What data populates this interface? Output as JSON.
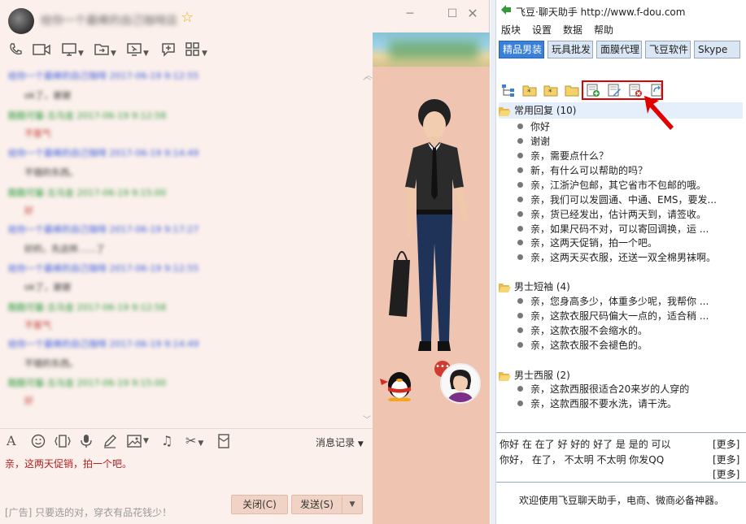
{
  "chat": {
    "contact_name": "给你一个最棒的自己咖啡店",
    "window_buttons": {
      "minimize": "─",
      "maximize": "☐",
      "close": "✕"
    },
    "messages": [
      {
        "kind": "header-blue",
        "text": "给你一个最棒的自己咖啡 2017-06-19 9:12:55"
      },
      {
        "kind": "body",
        "text": "ok了，谢谢"
      },
      {
        "kind": "header-green",
        "text": "酷酷可馨-五乌金 2017-06-19 9:12:58"
      },
      {
        "kind": "red",
        "text": "不客气"
      },
      {
        "kind": "header-blue",
        "text": "给你一个最棒的自己咖啡 2017-06-19 9:14:49"
      },
      {
        "kind": "body",
        "text": "不错的东西。"
      },
      {
        "kind": "header-green",
        "text": "酷酷可馨-五乌金 2017-06-19 9:15:00"
      },
      {
        "kind": "red",
        "text": "好"
      },
      {
        "kind": "header-blue",
        "text": "给你一个最棒的自己咖啡 2017-06-19 9:17:27"
      },
      {
        "kind": "body",
        "text": "好的，先这样……了"
      },
      {
        "kind": "header-blue",
        "text": "给你一个最棒的自己咖啡 2017-06-19 9:12:55"
      },
      {
        "kind": "body",
        "text": "ok了，谢谢"
      },
      {
        "kind": "header-green",
        "text": "酷酷可馨-五乌金 2017-06-19 9:12:58"
      },
      {
        "kind": "red",
        "text": "不客气"
      },
      {
        "kind": "header-blue",
        "text": "给你一个最棒的自己咖啡 2017-06-19 9:14:49"
      },
      {
        "kind": "body",
        "text": "不错的东西。"
      },
      {
        "kind": "header-green",
        "text": "酷酷可馨-五乌金 2017-06-19 9:15:00"
      },
      {
        "kind": "red",
        "text": "好"
      }
    ],
    "history_label": "消息记录",
    "input_text": "亲，这两天促销，拍一个吧。",
    "ad_text": "[广告] 只要选的对，穿衣有品花钱少！",
    "close_label": "关闭(C)",
    "send_label": "发送(S)",
    "badge": "•••"
  },
  "helper": {
    "title": "飞豆·聊天助手 http://www.f-dou.com",
    "menu": [
      "版块",
      "设置",
      "数据",
      "帮助"
    ],
    "tabs": [
      "精品男装",
      "玩具批发",
      "面膜代理",
      "飞豆软件",
      "Skype"
    ],
    "groups": [
      {
        "name": "常用回复 (10)",
        "items": [
          "你好",
          "谢谢",
          "亲，需要点什么？",
          "新，有什么可以帮助的吗？",
          "亲，江浙沪包邮，其它省市不包邮的哦。",
          "亲，我们可以发圆通、中通、EMS，要发...",
          "亲，货已经发出，估计两天到，请签收。",
          "亲，如果尺码不对，可以寄回调换，运 ...",
          "亲，这两天促销，拍一个吧。",
          "亲，这两天买衣服，还送一双全棉男袜啊。"
        ]
      },
      {
        "name": "男士短袖 (4)",
        "items": [
          "亲，您身高多少，体重多少呢，我帮你 ...",
          "亲，这款衣服尺码偏大一点的，适合稍 ...",
          "亲，这款衣服不会缩水的。",
          "亲，这款衣服不会褪色的。"
        ]
      },
      {
        "name": "男士西服 (2)",
        "items": [
          "亲，这款西服很适合20来岁的人穿的",
          "亲，这款西服不要水洗，请干洗。"
        ]
      }
    ],
    "quick_lines": [
      "你好  在  在了  好  好的  好了  是  是的  可以",
      "你好，  在了，  不太明  不太明  你发QQ"
    ],
    "more_label": "[更多]",
    "footer": "欢迎使用飞豆聊天助手，电商、微商必备神器。"
  }
}
